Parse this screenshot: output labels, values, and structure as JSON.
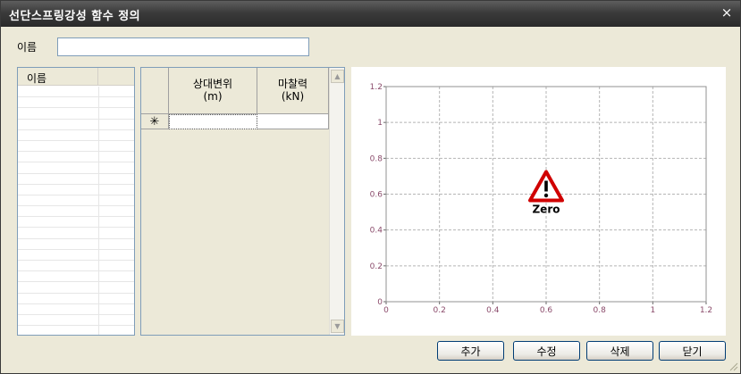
{
  "window": {
    "title": "선단스프링강성 함수 정의",
    "close_glyph": "×"
  },
  "name_field": {
    "label": "이름",
    "value": ""
  },
  "name_list": {
    "header": "이름"
  },
  "function_table": {
    "columns": [
      {
        "line1": "상대변위",
        "line2": "(m)"
      },
      {
        "line1": "마찰력",
        "line2": "(kN)"
      }
    ],
    "new_row_marker": "✳"
  },
  "chart_data": {
    "type": "line",
    "series": [],
    "xlim": [
      0,
      1.2
    ],
    "ylim": [
      0,
      1.2
    ],
    "xticks": [
      "0",
      "0.2",
      "0.4",
      "0.6",
      "0.8",
      "1",
      "1.2"
    ],
    "yticks": [
      "0",
      "0.2",
      "0.4",
      "0.6",
      "0.8",
      "1",
      "1.2"
    ],
    "grid": true,
    "warning_text": "Zero",
    "tick_color": "#8a4a6a"
  },
  "buttons": {
    "add": "추가",
    "edit": "수정",
    "delete": "삭제",
    "close": "닫기"
  }
}
